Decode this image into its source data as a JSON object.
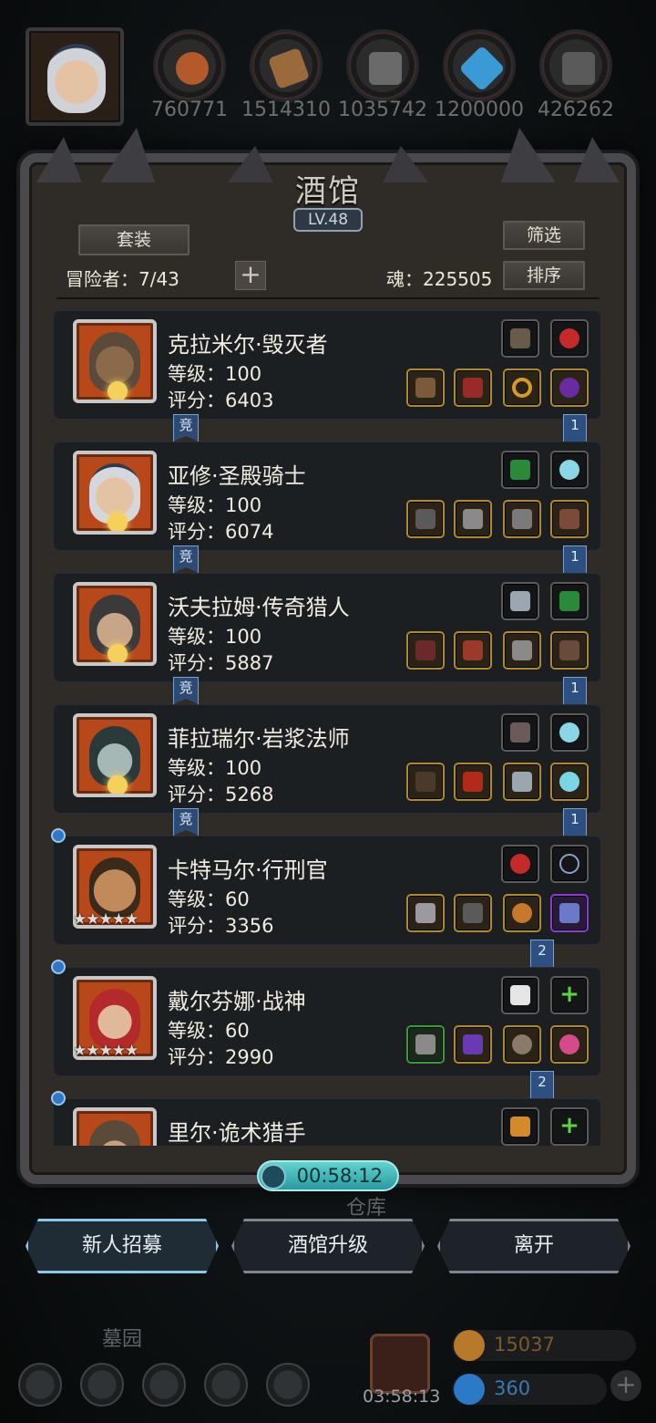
{
  "resources": [
    {
      "name": "meat-icon",
      "value": "760771",
      "color": "#b45a2a"
    },
    {
      "name": "wood-icon",
      "value": "1514310",
      "color": "#9a6a3a"
    },
    {
      "name": "stone-icon",
      "value": "1035742",
      "color": "#6a6a6a"
    },
    {
      "name": "crystal-icon",
      "value": "1200000",
      "color": "#3a9ad6"
    },
    {
      "name": "iron-icon",
      "value": "426262",
      "color": "#5a5a5a"
    }
  ],
  "tavern": {
    "title": "酒馆",
    "level": "LV.48",
    "suit_label": "套装",
    "filter_label": "筛选",
    "sort_label": "排序",
    "adventurers": "冒险者：7/43",
    "soul": "魂：225505",
    "plus": "+"
  },
  "heroes": [
    {
      "name": "克拉米尔·毁灭者",
      "level": "等级：100",
      "score": "评分：6403",
      "tag": "竞",
      "rank": "1"
    },
    {
      "name": "亚修·圣殿骑士",
      "level": "等级：100",
      "score": "评分：6074",
      "tag": "竞",
      "rank": "1"
    },
    {
      "name": "沃夫拉姆·传奇猎人",
      "level": "等级：100",
      "score": "评分：5887",
      "tag": "竞",
      "rank": "1"
    },
    {
      "name": "菲拉瑞尔·岩浆法师",
      "level": "等级：100",
      "score": "评分：5268",
      "tag": "竞",
      "rank": "1"
    },
    {
      "name": "卡特马尔·行刑官",
      "level": "等级：60",
      "score": "评分：3356",
      "stars": "★★★★★",
      "rank": "2"
    },
    {
      "name": "戴尔芬娜·战神",
      "level": "等级：60",
      "score": "评分：2990",
      "stars": "★★★★★",
      "rank": "2"
    },
    {
      "name": "里尔·诡术猎手"
    }
  ],
  "timer": "00:58:12",
  "buttons": {
    "recruit": "新人招募",
    "upgrade": "酒馆升级",
    "leave": "离开"
  },
  "world": {
    "warehouse": "仓库",
    "cemetery": "墓园"
  },
  "bottom": {
    "gift_timer": "03:58:13",
    "gold": "15037",
    "gems": "360",
    "plus": "+"
  }
}
